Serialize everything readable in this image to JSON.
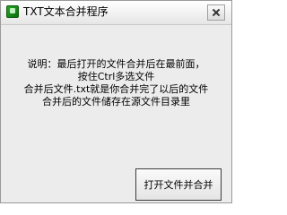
{
  "window": {
    "title": "TXT文本合并程序"
  },
  "message": {
    "lines": [
      "说明：最后打开的文件合并后在最前面，",
      "按住Ctrl多选文件",
      "合并后文件.txt就是你合并完了以后的文件",
      "合并后的文件储存在源文件目录里"
    ]
  },
  "actions": {
    "merge_label": "打开文件并合并"
  },
  "icons": {
    "app": "app-icon",
    "close": "close-icon"
  },
  "colors": {
    "window_bg": "#ececec",
    "titlebar_bg": "#f2f2f2",
    "app_icon": "#1e9a1e"
  }
}
